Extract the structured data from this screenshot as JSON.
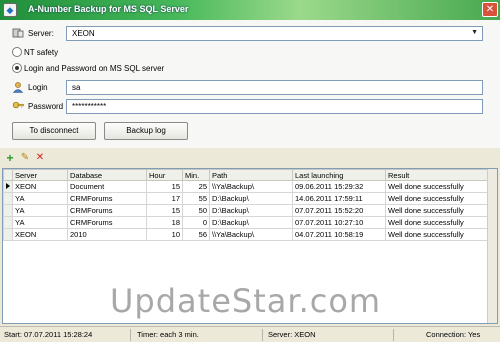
{
  "window": {
    "title": "A-Number Backup for MS SQL Server"
  },
  "form": {
    "server_label": "Server:",
    "server_value": "XEON",
    "nt_safety_label": "NT safety",
    "login_password_label": "Login and Password on MS SQL server",
    "login_label": "Login",
    "login_value": "sa",
    "password_label": "Password",
    "password_value": "***********",
    "disconnect_label": "To disconnect",
    "backup_log_label": "Backup log"
  },
  "toolbar": {
    "add": "+",
    "edit": "✎",
    "delete": "✕"
  },
  "table": {
    "columns": [
      "Server",
      "Database",
      "Hour",
      "Min.",
      "Path",
      "Last launching",
      "Result"
    ],
    "rows": [
      [
        "XEON",
        "Document",
        "15",
        "25",
        "\\\\Ya\\Backup\\",
        "09.06.2011 15:29:32",
        "Well done successfully"
      ],
      [
        "YA",
        "CRMForums",
        "17",
        "55",
        "D:\\Backup\\",
        "14.06.2011 17:59:11",
        "Well done successfully"
      ],
      [
        "YA",
        "CRMForums",
        "15",
        "50",
        "D:\\Backup\\",
        "07.07.2011 15:52:20",
        "Well done successfully"
      ],
      [
        "YA",
        "CRMForums",
        "18",
        "0",
        "D:\\Backup\\",
        "07.07.2011 10:27:10",
        "Well done successfully"
      ],
      [
        "XEON",
        "2010",
        "10",
        "56",
        "\\\\Ya\\Backup\\",
        "04.07.2011 10:58:19",
        "Well done successfully"
      ]
    ]
  },
  "watermark": "UpdateStar.com",
  "status": {
    "start": "Start: 07.07.2011 15:28:24",
    "timer": "Timer: each 3 min.",
    "server": "Server: XEON",
    "connection": "Connection: Yes"
  }
}
